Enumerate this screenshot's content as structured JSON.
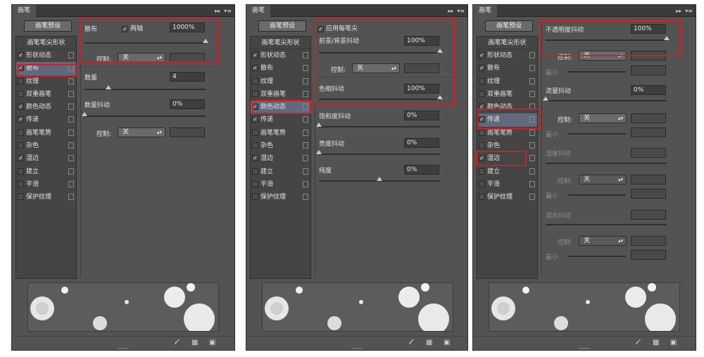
{
  "panel_title": "画笔",
  "preset_button": "画笔预设",
  "sidebar_header": "画笔笔尖形状",
  "sidebar_items": [
    "形状动态",
    "散布",
    "纹理",
    "双重画笔",
    "颜色动态",
    "传递",
    "画笔笔势",
    "杂色",
    "湿边",
    "建立",
    "平滑",
    "保护纹理"
  ],
  "panel1": {
    "checked": [
      true,
      true,
      false,
      false,
      true,
      true,
      false,
      false,
      true,
      false,
      false,
      false
    ],
    "selected": "散布",
    "scatter_label": "散布",
    "both_axes_label": "两轴",
    "both_axes_checked": true,
    "scatter_value": "1000%",
    "scatter_slider": 1.0,
    "control_label": "控制:",
    "control_value": "关",
    "count_label": "数量",
    "count_value": "4",
    "count_slider": 0.2,
    "count_jitter_label": "数量抖动",
    "count_jitter_value": "0%",
    "count_jitter_slider": 0.0,
    "control2_value": "关"
  },
  "panel2": {
    "checked": [
      true,
      true,
      false,
      false,
      true,
      true,
      false,
      false,
      true,
      false,
      false,
      false
    ],
    "selected": "颜色动态",
    "apply_per_tip_label": "应用每笔尖",
    "apply_per_tip_checked": true,
    "fgbg_label": "前景/背景抖动",
    "fgbg_value": "100%",
    "fgbg_slider": 1.0,
    "control_label": "控制:",
    "control_value": "关",
    "hue_label": "色相抖动",
    "hue_value": "100%",
    "hue_slider": 1.0,
    "saturation_label": "饱和度抖动",
    "saturation_value": "0%",
    "saturation_slider": 0.0,
    "brightness_label": "亮度抖动",
    "brightness_value": "0%",
    "brightness_slider": 0.0,
    "purity_label": "纯度",
    "purity_value": "0%",
    "purity_slider": 0.5
  },
  "panel3": {
    "checked": [
      true,
      true,
      false,
      false,
      true,
      true,
      false,
      false,
      true,
      false,
      false,
      false
    ],
    "selected": "传递",
    "opacity_jitter_label": "不透明度抖动",
    "opacity_jitter_value": "100%",
    "opacity_slider": 1.0,
    "control_label": "控制:",
    "control_value": "关",
    "min_label": "最小",
    "flow_jitter_label": "流量抖动",
    "flow_jitter_value": "0%",
    "flow_slider": 0.0,
    "control2_value": "关",
    "wetness_jitter_label": "湿度抖动",
    "control3_value": "关",
    "mix_jitter_label": "混合抖动",
    "control4_value": "关"
  },
  "colors": {
    "panel_bg": "#535353",
    "highlight_box": "#d01f26",
    "selected_row": "#5f6a7d"
  },
  "icons": [
    "double-arrow-icon",
    "panel-menu-icon",
    "lock-icon",
    "brush-toggle-icon",
    "grid-icon",
    "new-preset-icon"
  ]
}
